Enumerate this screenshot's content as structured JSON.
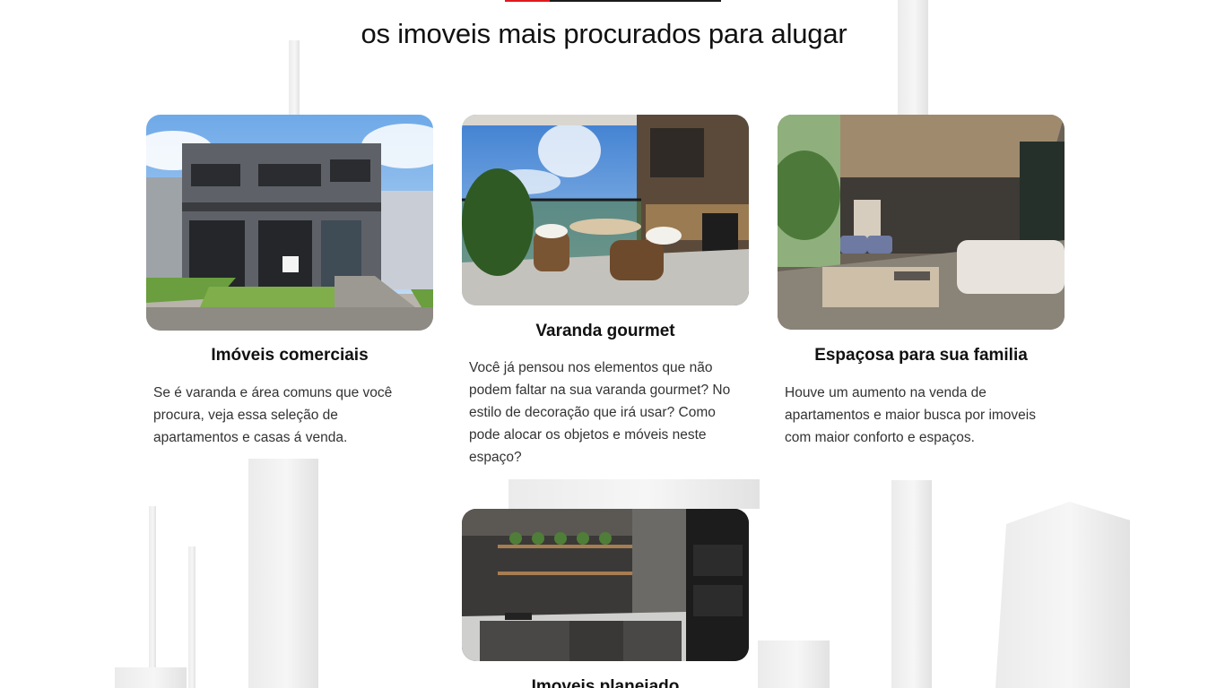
{
  "section": {
    "title": "os imoveis mais procurados para alugar"
  },
  "colors": {
    "accent_red": "#e0191f",
    "accent_dark": "#1b1b1b"
  },
  "cards": [
    {
      "title": "Imóveis comerciais",
      "text": "Se é varanda e área comuns que você procura, veja essa seleção de apartamentos e casas á venda.",
      "image": "commercial-building-photo"
    },
    {
      "title": "Varanda gourmet",
      "text": "Você já pensou nos elementos que não podem faltar na sua varanda gourmet? No estilo de decoração que irá usar? Como pode alocar os objetos e móveis neste espaço?",
      "image": "gourmet-balcony-photo"
    },
    {
      "title": "Espaçosa para sua familia",
      "text": "Houve um aumento na venda de apartamentos e maior busca por imoveis com maior conforto e espaços.",
      "image": "spacious-living-room-photo"
    },
    {
      "title": "Imoveis planejado",
      "text": "",
      "image": "planned-kitchen-photo"
    }
  ]
}
